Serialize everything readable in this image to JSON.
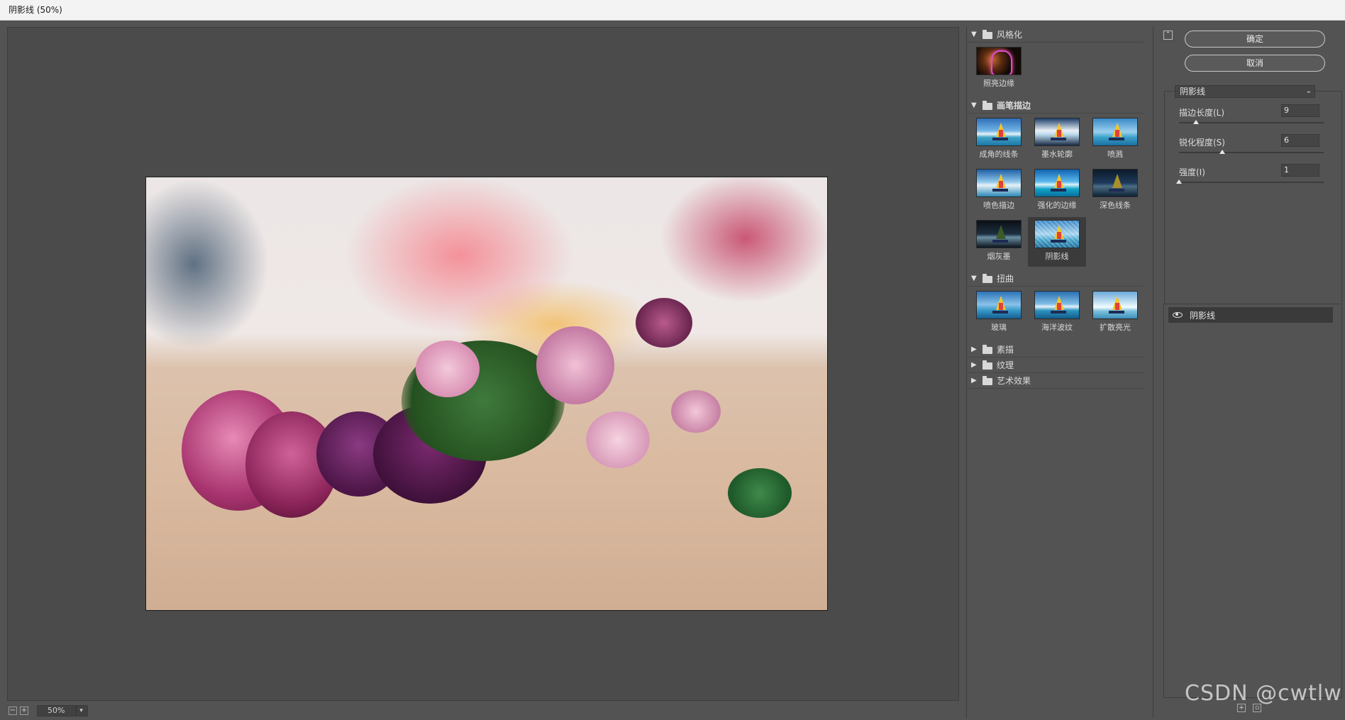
{
  "window": {
    "title": "阴影线 (50%)"
  },
  "preview": {
    "zoom": "50%"
  },
  "gallery": {
    "categories": [
      {
        "name": "风格化",
        "expanded": true,
        "filters": [
          {
            "label": "照亮边缘"
          }
        ]
      },
      {
        "name": "画笔描边",
        "expanded": true,
        "filters": [
          {
            "label": "成角的线条"
          },
          {
            "label": "墨水轮廓"
          },
          {
            "label": "喷溅"
          },
          {
            "label": "喷色描边"
          },
          {
            "label": "强化的边缘"
          },
          {
            "label": "深色线条"
          },
          {
            "label": "烟灰墨"
          },
          {
            "label": "阴影线"
          }
        ]
      },
      {
        "name": "扭曲",
        "expanded": true,
        "filters": [
          {
            "label": "玻璃"
          },
          {
            "label": "海洋波纹"
          },
          {
            "label": "扩散亮光"
          }
        ]
      },
      {
        "name": "素描",
        "expanded": false
      },
      {
        "name": "纹理",
        "expanded": false
      },
      {
        "name": "艺术效果",
        "expanded": false
      }
    ],
    "selected": "阴影线"
  },
  "settings": {
    "ok_label": "确定",
    "cancel_label": "取消",
    "filter_select": "阴影线",
    "params": [
      {
        "label": "描边长度(L)",
        "value": "9",
        "fraction": 0.12
      },
      {
        "label": "锐化程度(S)",
        "value": "6",
        "fraction": 0.3
      },
      {
        "label": "强度(I)",
        "value": "1",
        "fraction": 0.0
      }
    ]
  },
  "layers": {
    "items": [
      {
        "name": "阴影线"
      }
    ]
  },
  "watermark": "CSDN @cwtlw"
}
